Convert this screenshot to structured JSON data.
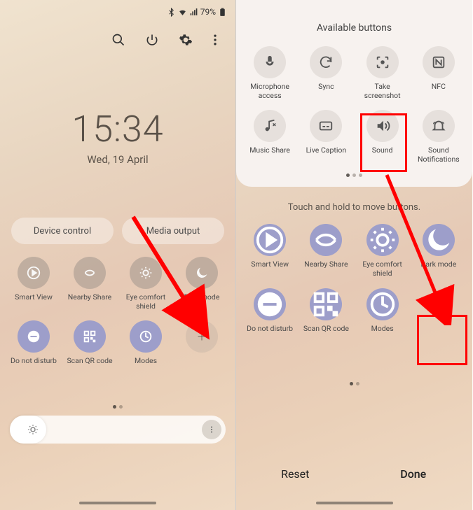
{
  "left": {
    "status": {
      "battery_text": "79%"
    },
    "clock": {
      "time": "15:34",
      "date": "Wed, 19 April"
    },
    "pills": {
      "device": "Device control",
      "media": "Media output"
    },
    "qs": {
      "smartview": "Smart View",
      "nearby": "Nearby Share",
      "eye": "Eye comfort shield",
      "dark": "Dark mode",
      "dnd": "Do not disturb",
      "qr": "Scan QR code",
      "modes": "Modes"
    }
  },
  "right": {
    "avail_title": "Available buttons",
    "avail": {
      "mic": "Microphone access",
      "sync": "Sync",
      "shot": "Take screenshot",
      "nfc": "NFC",
      "mshare": "Music Share",
      "caption": "Live Caption",
      "sound": "Sound",
      "snotif": "Sound Notifications"
    },
    "hint": "Touch and hold to move buttons.",
    "qs": {
      "smartview": "Smart View",
      "nearby": "Nearby Share",
      "eye": "Eye comfort shield",
      "dark": "Dark mode",
      "dnd": "Do not disturb",
      "qr": "Scan QR code",
      "modes": "Modes"
    },
    "reset": "Reset",
    "done": "Done"
  }
}
